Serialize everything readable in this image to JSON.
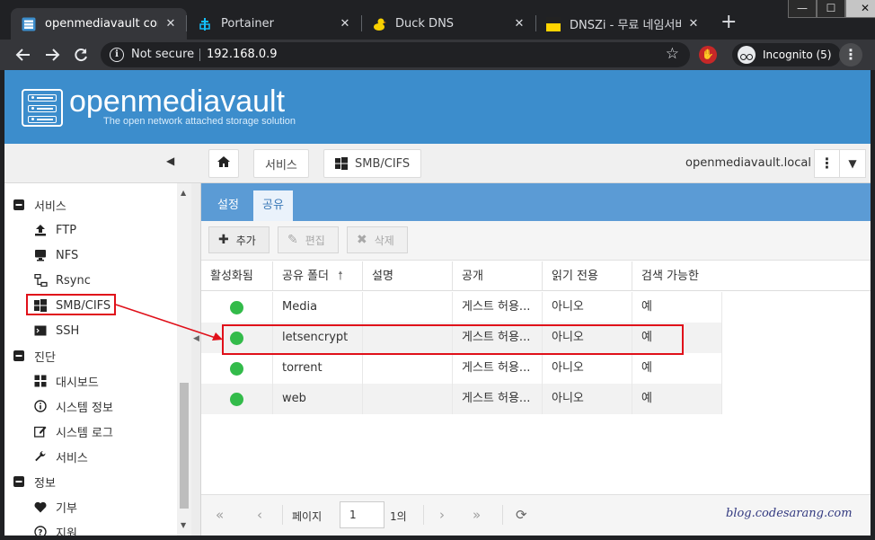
{
  "browser": {
    "tabs": [
      {
        "title": "openmediavault control",
        "favicon": "omv-favicon",
        "active": true
      },
      {
        "title": "Portainer",
        "favicon": "portainer-favicon",
        "active": false
      },
      {
        "title": "Duck DNS",
        "favicon": "duck-favicon",
        "active": false
      },
      {
        "title": "DNSZi - 무료 네임서버(d",
        "favicon": "dnszi-favicon",
        "active": false
      }
    ],
    "tab_close": "✕",
    "new_tab": "+",
    "security_label": "Not secure",
    "url": "192.168.0.9",
    "incognito_label": "Incognito (5)",
    "window_controls": {
      "minimize": "—",
      "maximize": "☐",
      "close": "✕"
    }
  },
  "header": {
    "title": "openmediavault",
    "subtitle": "The open network attached storage solution",
    "brand_color": "#3c8dcc"
  },
  "breadcrumb": {
    "items": [
      "서비스",
      "SMB/CIFS"
    ]
  },
  "hostname": "openmediavault.local",
  "sidebar": {
    "items": [
      {
        "label": "서비스",
        "icon": "minus-square-icon",
        "level": 0
      },
      {
        "label": "FTP",
        "icon": "upload-icon",
        "level": 1
      },
      {
        "label": "NFS",
        "icon": "desktop-icon",
        "level": 1
      },
      {
        "label": "Rsync",
        "icon": "sitemap-icon",
        "level": 1
      },
      {
        "label": "SMB/CIFS",
        "icon": "windows-icon",
        "level": 1
      },
      {
        "label": "SSH",
        "icon": "terminal-icon",
        "level": 1
      },
      {
        "label": "진단",
        "icon": "minus-square-icon",
        "level": 0
      },
      {
        "label": "대시보드",
        "icon": "dashboard-icon",
        "level": 1
      },
      {
        "label": "시스템 정보",
        "icon": "info-circle-icon",
        "level": 1
      },
      {
        "label": "시스템 로그",
        "icon": "edit-icon",
        "level": 1
      },
      {
        "label": "서비스",
        "icon": "wrench-icon",
        "level": 1
      },
      {
        "label": "정보",
        "icon": "minus-square-icon",
        "level": 0
      },
      {
        "label": "기부",
        "icon": "heart-icon",
        "level": 1
      },
      {
        "label": "지원",
        "icon": "question-circle-icon",
        "level": 1
      }
    ]
  },
  "panel": {
    "tabs": [
      {
        "label": "설정",
        "active": false
      },
      {
        "label": "공유",
        "active": true
      }
    ],
    "actions": {
      "add": "추가",
      "edit": "편집",
      "delete": "삭제"
    },
    "columns": [
      "활성화됨",
      "공유 폴더",
      "설명",
      "공개",
      "읽기 전용",
      "검색 가능한"
    ],
    "sort_indicator": "🠕",
    "rows": [
      {
        "enabled": true,
        "shared_folder": "Media",
        "comment": "",
        "public": "게스트 허용...",
        "read_only": "아니오",
        "browseable": "예"
      },
      {
        "enabled": true,
        "shared_folder": "letsencrypt",
        "comment": "",
        "public": "게스트 허용...",
        "read_only": "아니오",
        "browseable": "예"
      },
      {
        "enabled": true,
        "shared_folder": "torrent",
        "comment": "",
        "public": "게스트 허용...",
        "read_only": "아니오",
        "browseable": "예"
      },
      {
        "enabled": true,
        "shared_folder": "web",
        "comment": "",
        "public": "게스트 허용...",
        "read_only": "아니오",
        "browseable": "예"
      }
    ],
    "enabled_color": "#33bb4a"
  },
  "pager": {
    "page_label": "페이지",
    "page_value": "1",
    "of_label": "1의"
  },
  "watermark": "blog.codesarang.com",
  "annotation_color": "#e0101a"
}
